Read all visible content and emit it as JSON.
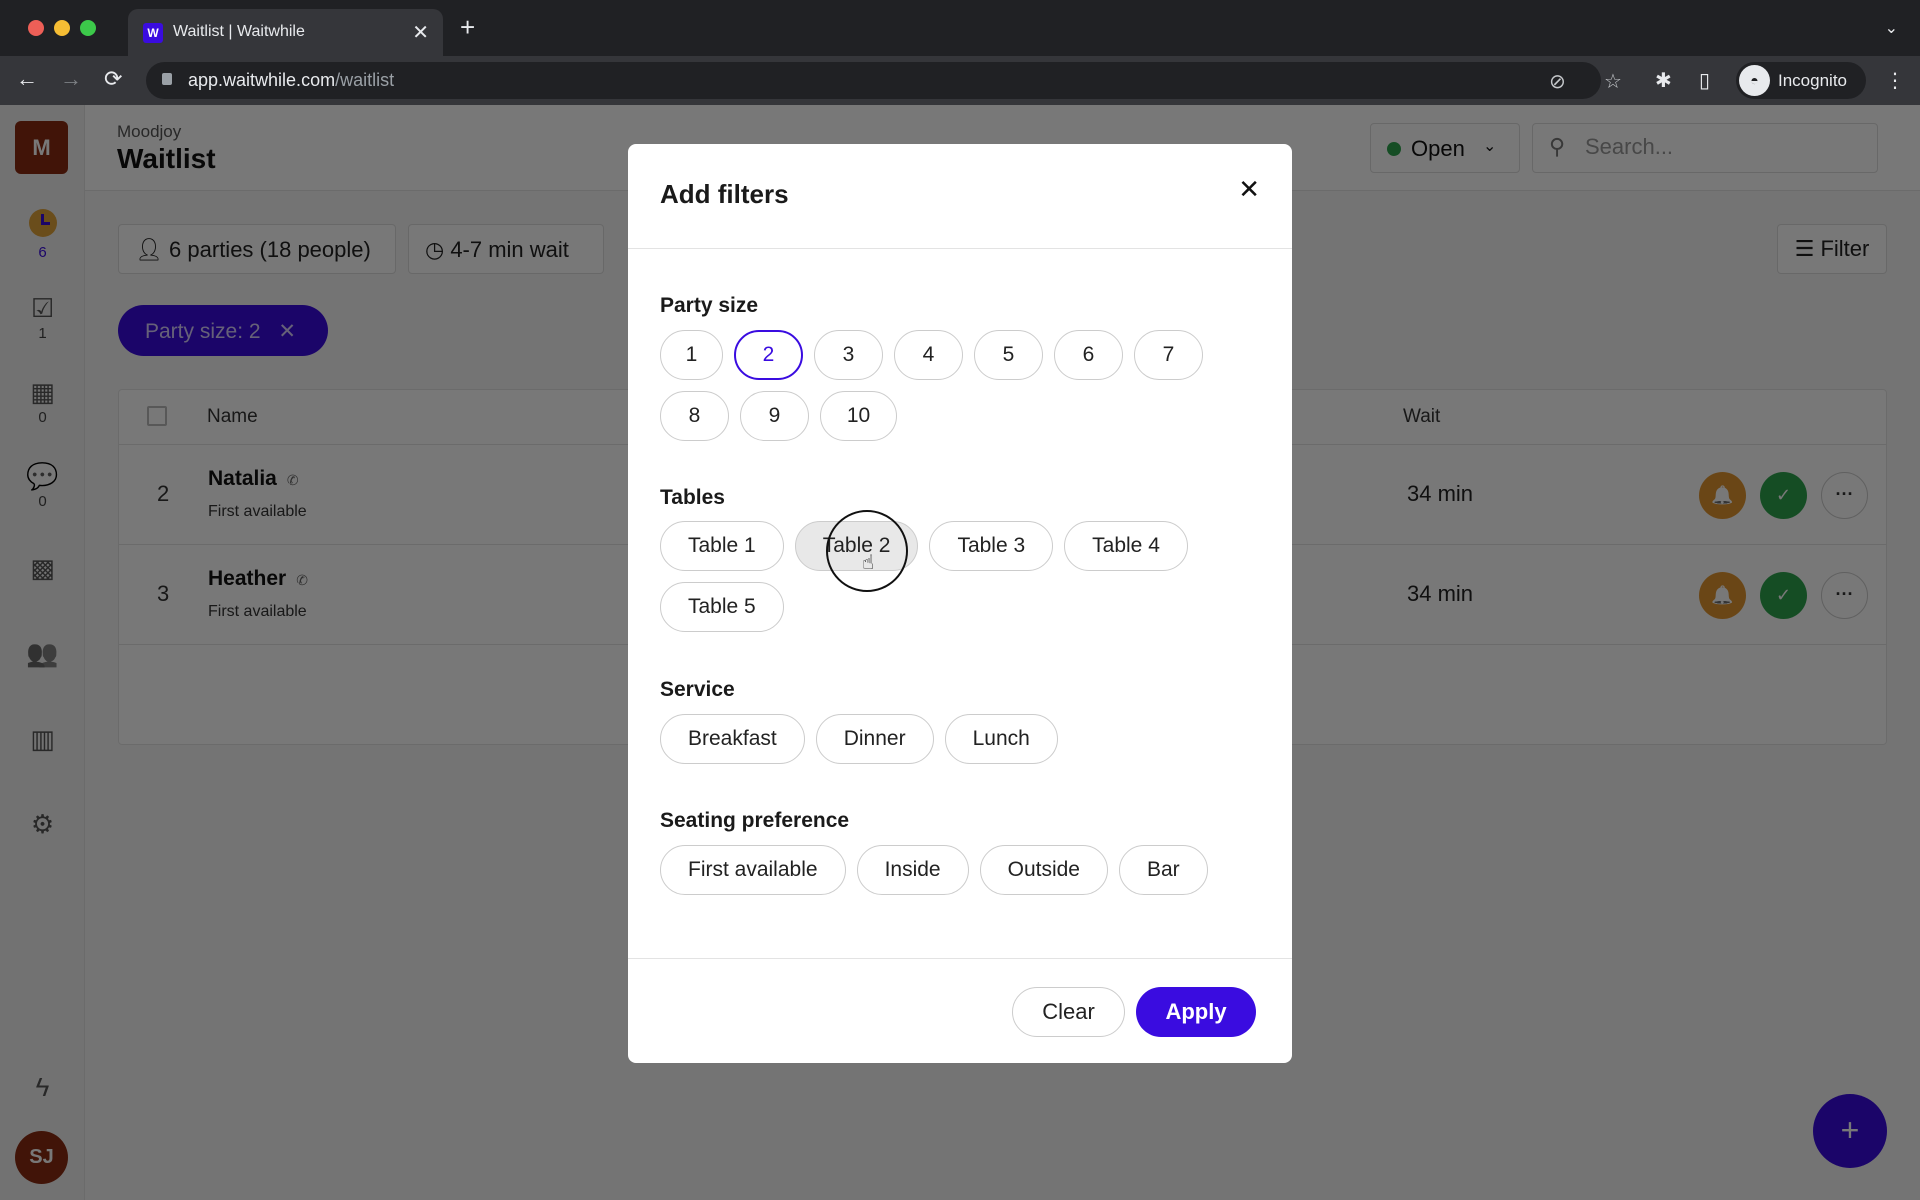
{
  "browser": {
    "tab_title": "Waitlist | Waitwhile",
    "tab_favicon": "W",
    "url_domain": "app.waitwhile.com",
    "url_path": "/waitlist",
    "profile_label": "Incognito",
    "icons": {
      "back": "←",
      "forward": "→",
      "reload": "⟳",
      "new_tab": "+",
      "close_tab": "✕",
      "tab_menu": "⌄",
      "eye_off": "⊘",
      "star": "☆",
      "extensions": "✱",
      "side_panel": "▯",
      "menu": "⋮",
      "incognito": "◓"
    }
  },
  "sidebar": {
    "org_initial": "M",
    "items": [
      {
        "name": "waitlist",
        "icon": "clock-icon",
        "count": "6",
        "active": true
      },
      {
        "name": "served",
        "icon": "checkbox-icon",
        "glyph": "☑",
        "count": "1"
      },
      {
        "name": "bookings",
        "icon": "calendar-icon",
        "glyph": "▦",
        "count": "0"
      },
      {
        "name": "messages",
        "icon": "chat-icon",
        "glyph": "💬",
        "count": "0"
      },
      {
        "name": "apps",
        "icon": "grid-icon",
        "glyph": "▩"
      },
      {
        "name": "customers",
        "icon": "users-icon",
        "glyph": "👥"
      },
      {
        "name": "analytics",
        "icon": "bar-chart-icon",
        "glyph": "▥"
      },
      {
        "name": "settings",
        "icon": "gear-icon",
        "glyph": "⚙"
      },
      {
        "name": "whats-new",
        "icon": "lightning-icon",
        "glyph": "ϟ"
      }
    ],
    "user_initials": "SJ"
  },
  "header": {
    "org_name": "Moodjoy",
    "title": "Waitlist",
    "status_label": "Open",
    "status_color": "#2da44e",
    "search_placeholder": "Search..."
  },
  "stats": {
    "parties": "6 parties (18 people)",
    "wait": "4-7 min wait",
    "filter_label": "Filter"
  },
  "active_filters": [
    {
      "label": "Party size: 2",
      "remove": "✕"
    }
  ],
  "table": {
    "columns": [
      "Name",
      "Wait"
    ],
    "rows": [
      {
        "position": "2",
        "name": "Natalia",
        "seating": "First available",
        "wait": "34 min"
      },
      {
        "position": "3",
        "name": "Heather",
        "seating": "First available",
        "wait": "34 min"
      }
    ],
    "actions": {
      "notify": "🔔",
      "serve": "✓",
      "more": "···"
    }
  },
  "fab_label": "+",
  "modal": {
    "title": "Add filters",
    "close": "✕",
    "sections": [
      {
        "label": "Party size",
        "options": [
          "1",
          "2",
          "3",
          "4",
          "5",
          "6",
          "7",
          "8",
          "9",
          "10"
        ],
        "selected": [
          "2"
        ]
      },
      {
        "label": "Tables",
        "options": [
          "Table 1",
          "Table 2",
          "Table 3",
          "Table 4",
          "Table 5"
        ],
        "hovered": "Table 2"
      },
      {
        "label": "Service",
        "options": [
          "Breakfast",
          "Dinner",
          "Lunch"
        ]
      },
      {
        "label": "Seating preference",
        "options": [
          "First available",
          "Inside",
          "Outside",
          "Bar"
        ]
      }
    ],
    "clear_label": "Clear",
    "apply_label": "Apply"
  },
  "colors": {
    "brand": "#3a0ce0",
    "notify": "#e2952f",
    "serve": "#2da44e",
    "org_avatar": "#8b2c12"
  }
}
